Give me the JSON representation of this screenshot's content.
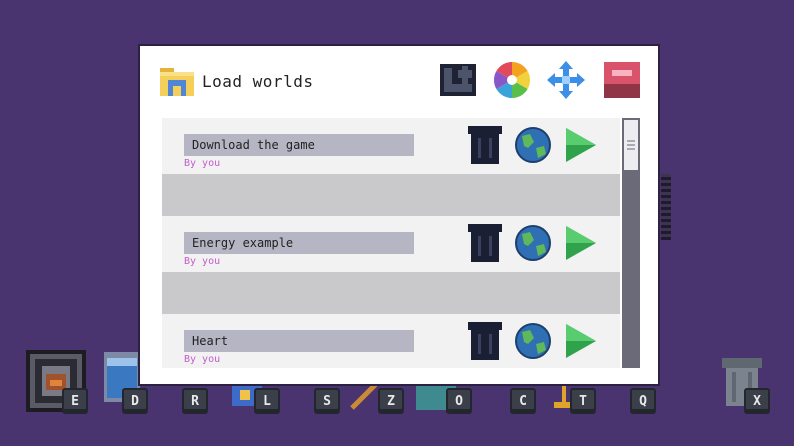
{
  "dialog": {
    "title": "Load worlds",
    "folder_icon": "folder-icon",
    "toolbar": [
      {
        "name": "import-button",
        "icon": "puzzle-arrow-icon"
      },
      {
        "name": "color-wheel-button",
        "icon": "color-wheel-icon"
      },
      {
        "name": "move-button",
        "icon": "four-way-arrow-icon"
      },
      {
        "name": "close-button",
        "icon": "close-square-icon"
      }
    ]
  },
  "worlds": [
    {
      "name": "Download the game",
      "author": "By you"
    },
    {
      "name": "Energy example",
      "author": "By you"
    },
    {
      "name": "Heart",
      "author": "By you"
    }
  ],
  "row_actions": {
    "delete_icon": "trash-icon",
    "world_icon": "globe-icon",
    "play_icon": "play-icon"
  },
  "hotbar": {
    "keys": [
      "E",
      "D",
      "R",
      "L",
      "S",
      "Z",
      "O",
      "C",
      "T",
      "Q",
      "X"
    ]
  },
  "colors": {
    "background": "#4a3470",
    "author_text": "#c35cc9",
    "name_box": "#b6b5c3",
    "play_green": "#2fa24b"
  }
}
